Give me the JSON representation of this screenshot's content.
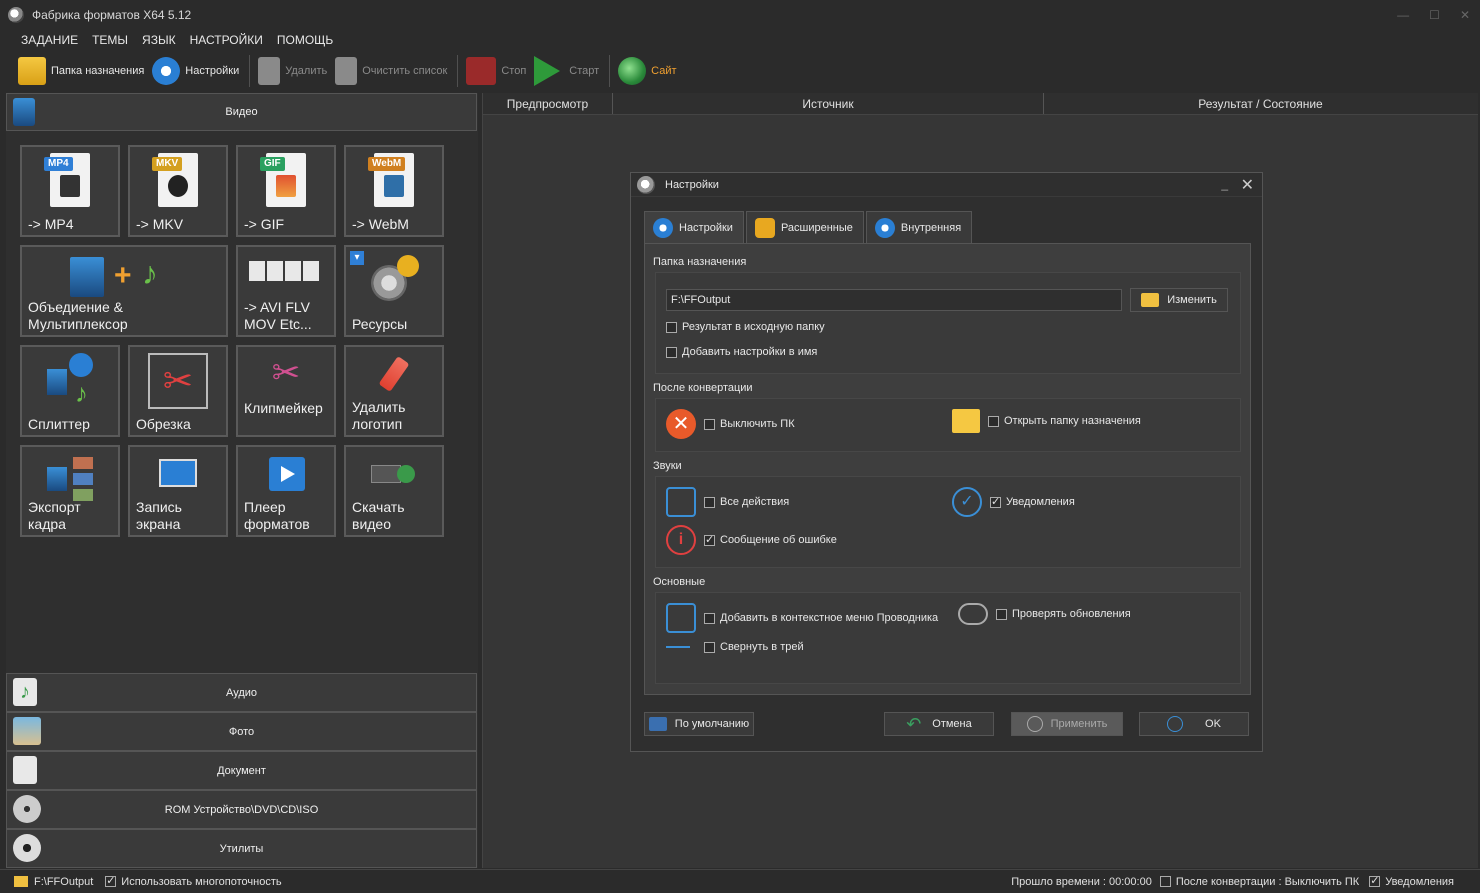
{
  "window": {
    "title": "Фабрика форматов X64 5.12"
  },
  "menu": [
    "ЗАДАНИЕ",
    "ТЕМЫ",
    "ЯЗЫК",
    "НАСТРОЙКИ",
    "ПОМОЩЬ"
  ],
  "toolbar": {
    "dest_folder": "Папка назначения",
    "settings": "Настройки",
    "delete": "Удалить",
    "clear_list": "Очистить список",
    "stop": "Стоп",
    "start": "Старт",
    "site": "Сайт"
  },
  "left": {
    "video_header": "Видео",
    "tiles": [
      {
        "label": "-> MP4",
        "badge": "MP4",
        "color": "#2f7fd6"
      },
      {
        "label": "-> MKV",
        "badge": "MKV",
        "color": "#d4a020"
      },
      {
        "label": "-> GIF",
        "badge": "GIF",
        "color": "#2aa060"
      },
      {
        "label": "-> WebM",
        "badge": "WebM",
        "color": "#d08020"
      },
      {
        "label": "Объедиение & Мультиплексор",
        "line1": "Объедиение &",
        "line2": "Мультиплексор"
      },
      {
        "label": "-> AVI FLV MOV Etc...",
        "line1": "-> AVI FLV",
        "line2": "MOV Etc..."
      },
      {
        "label": "Ресурсы"
      },
      {
        "label": "Сплиттер"
      },
      {
        "label": "Обрезка"
      },
      {
        "label": "Клипмейкер"
      },
      {
        "label": "Удалить логотип",
        "line1": "Удалить",
        "line2": "логотип"
      },
      {
        "label": "Экспорт кадра",
        "line1": "Экспорт",
        "line2": "кадра"
      },
      {
        "label": "Запись экрана",
        "line1": "Запись",
        "line2": "экрана"
      },
      {
        "label": "Плеер форматов",
        "line1": "Плеер",
        "line2": "форматов"
      },
      {
        "label": "Скачать видео",
        "line1": "Скачать",
        "line2": "видео"
      }
    ],
    "categories": [
      "Аудио",
      "Фото",
      "Документ",
      "ROM Устройство\\DVD\\CD\\ISO",
      "Утилиты"
    ]
  },
  "table": {
    "columns": [
      "Предпросмотр",
      "Источник",
      "Результат / Состояние"
    ]
  },
  "dialog": {
    "title": "Настройки",
    "tabs": [
      "Настройки",
      "Расширенные",
      "Внутренняя"
    ],
    "dest_section": "Папка назначения",
    "path_value": "F:\\FFOutput",
    "change_button": "Изменить",
    "result_src_folder": "Результат в исходную папку",
    "add_settings_name": "Добавить настройки в имя",
    "after_section": "После конвертации",
    "shutdown": "Выключить ПК",
    "open_dest": "Открыть папку назначения",
    "sounds_section": "Звуки",
    "all_actions": "Все действия",
    "notifications": "Уведомления",
    "error_msg": "Сообщение об ошибке",
    "main_section": "Основные",
    "context_menu": "Добавить в контекстное меню Проводника",
    "check_updates": "Проверять обновления",
    "minimize_tray": "Свернуть в трей",
    "default_button": "По умолчанию",
    "cancel_button": "Отмена",
    "apply_button": "Применить",
    "ok_button": "OK"
  },
  "status": {
    "path": "F:\\FFOutput",
    "multithread": "Использовать многопоточность",
    "elapsed": "Прошло времени : 00:00:00",
    "after_conv": "После конвертации : Выключить ПК",
    "notifications": "Уведомления"
  }
}
